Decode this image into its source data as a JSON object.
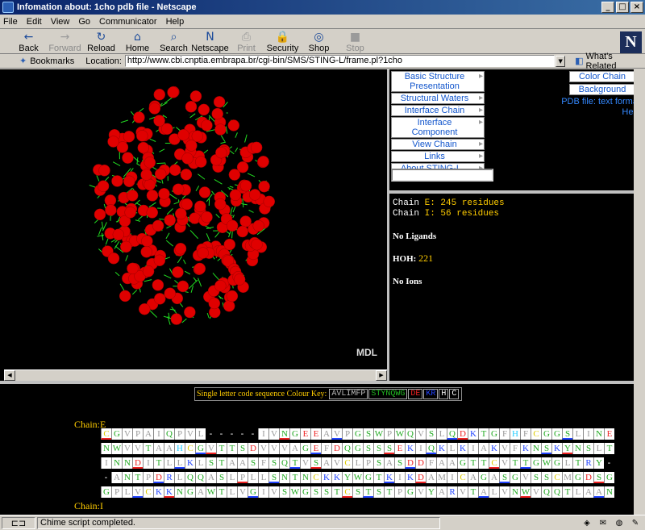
{
  "window": {
    "title": "Infomation about: 1cho pdb file - Netscape",
    "minimize": "_",
    "maximize": "□",
    "close": "×"
  },
  "menu": [
    "File",
    "Edit",
    "View",
    "Go",
    "Communicator",
    "Help"
  ],
  "toolbar": [
    {
      "label": "Back",
      "icon": "←",
      "disabled": false
    },
    {
      "label": "Forward",
      "icon": "→",
      "disabled": true
    },
    {
      "label": "Reload",
      "icon": "↻",
      "disabled": false
    },
    {
      "label": "Home",
      "icon": "⌂",
      "disabled": false
    },
    {
      "label": "Search",
      "icon": "⌕",
      "disabled": false
    },
    {
      "label": "Netscape",
      "icon": "N",
      "disabled": false
    },
    {
      "label": "Print",
      "icon": "⎙",
      "disabled": true
    },
    {
      "label": "Security",
      "icon": "🔒",
      "disabled": false
    },
    {
      "label": "Shop",
      "icon": "◎",
      "disabled": false
    },
    {
      "label": "Stop",
      "icon": "■",
      "disabled": true
    }
  ],
  "logo": "N",
  "location": {
    "bookmarks_label": "Bookmarks",
    "location_label": "Location:",
    "url": "http://www.cbi.cnptia.embrapa.br/cgi-bin/SMS/STING-L/frame.pl?1cho",
    "related_label": "What's Related"
  },
  "viewer": {
    "badge": "MDL"
  },
  "side_menu": [
    "Basic Structure Presentation",
    "Structural Waters",
    "Interface Chain",
    "Interface Component",
    "View Chain",
    "Links",
    "About STING-L..."
  ],
  "right_panel": {
    "color_chain": "Color Chain",
    "background": "Background",
    "pdb_link": "PDB file: text format",
    "help": "Help",
    "accent": "#ee0000"
  },
  "info": {
    "chain_e_label": "Chain ",
    "chain_e_id": "E",
    "chain_e_count": ": 245 residues",
    "chain_i_label": "Chain ",
    "chain_i_id": "I",
    "chain_i_count": ": 56 residues",
    "ligands": "No Ligands",
    "hoh_label": "HOH: ",
    "hoh_value": "221",
    "ions": "No Ions"
  },
  "color_key": {
    "label": "Single letter code sequence Colour Key:",
    "groups": [
      {
        "text": "AVLIMFP",
        "color": "#bbbbbb"
      },
      {
        "text": "STYNQWG",
        "color": "#22bb22"
      },
      {
        "text": "DE",
        "color": "#ee2222"
      },
      {
        "text": "KR",
        "color": "#2244ff"
      },
      {
        "text": "H",
        "color": "#ffffff"
      },
      {
        "text": "C",
        "color": "#ffffff"
      }
    ]
  },
  "chain_label": "Chain:E",
  "chain_label_2": "Chain:I",
  "sequence_rows": [
    "CGVPAIQPVL-----IVNGEEAVPGSWPWQVSLQDKTGFHFCGGSLINE",
    "NWVVTAAHCGVTTSDVVVAGEFDQGSSSEKIQKLKIAKVFKNSKYNSLT",
    "INNDITLLKLSTAASFSQTVSAVCLPSASDDFAAGTTCVTTGWGLTRY-",
    "-ANTPDRLQQASLPLLSNTNCKKYWGTKIKDAMICAGASGVSSCMGDSG",
    "GPLVCKKNGAWTLVGIVSWGSSTCSTSTPGVYARVTALVNWVQQTLAAN"
  ],
  "residue_colors": {
    "A": "#999999",
    "V": "#999999",
    "L": "#999999",
    "I": "#999999",
    "M": "#999999",
    "F": "#999999",
    "P": "#999999",
    "S": "#22aa22",
    "T": "#22aa22",
    "Y": "#22aa22",
    "N": "#22aa22",
    "Q": "#22aa22",
    "W": "#22aa22",
    "G": "#22aa22",
    "D": "#ee2222",
    "E": "#ee2222",
    "K": "#2244ff",
    "R": "#2244ff",
    "H": "#22ccff",
    "C": "#ddcc00"
  },
  "status": {
    "message": "Chime script completed."
  }
}
